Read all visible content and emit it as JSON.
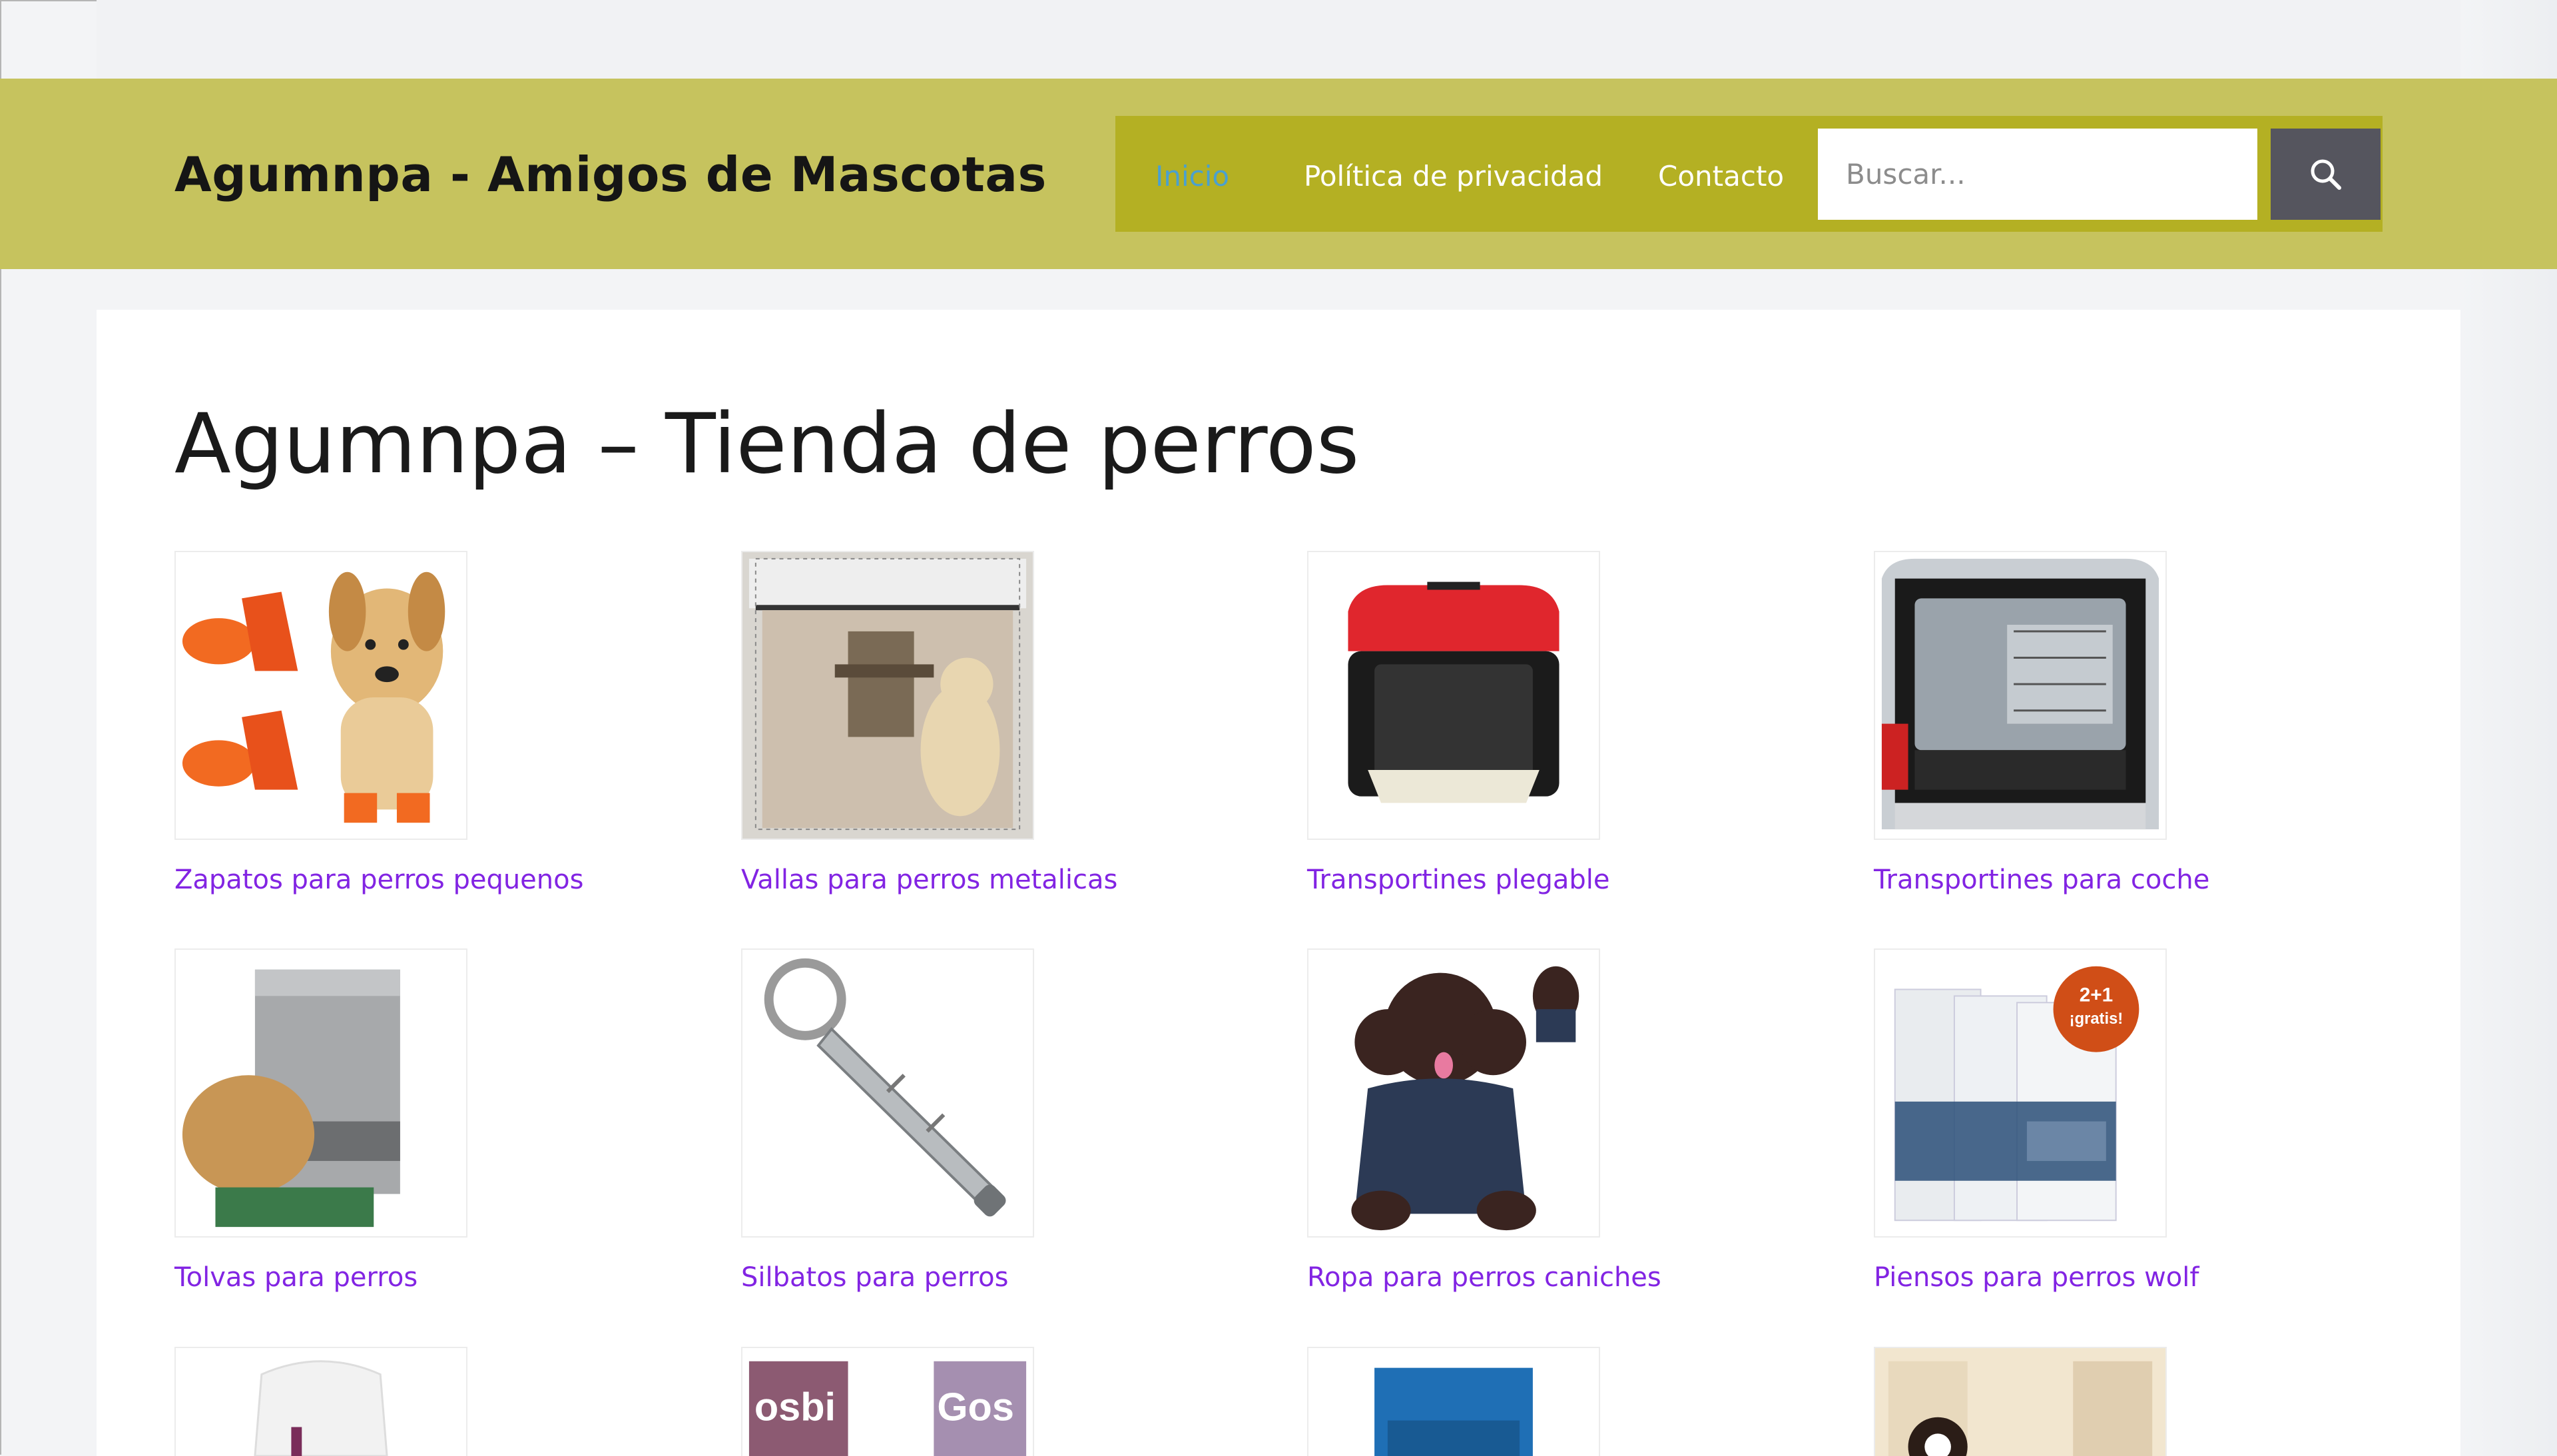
{
  "site": {
    "title": "Agumnpa - Amigos de Mascotas"
  },
  "nav": {
    "items": [
      {
        "label": "Inicio",
        "active": true
      },
      {
        "label": "Política de privacidad",
        "active": false
      },
      {
        "label": "Contacto",
        "active": false
      }
    ]
  },
  "search": {
    "placeholder": "Buscar...",
    "value": "",
    "icon": "search-icon"
  },
  "main": {
    "title": "Agumnpa – Tienda de perros",
    "products": [
      {
        "label": "Zapatos para perros pequenos",
        "image": "puppy-with-orange-shoes"
      },
      {
        "label": "Vallas para perros metalicas",
        "image": "dog-behind-mesh-fence"
      },
      {
        "label": "Transportines plegable",
        "image": "red-black-soft-crate"
      },
      {
        "label": "Transportines para coche",
        "image": "crate-in-car-trunk"
      },
      {
        "label": "Tolvas para perros",
        "image": "dog-eating-from-metal-feeder"
      },
      {
        "label": "Silbatos para perros",
        "image": "silver-dog-whistle"
      },
      {
        "label": "Ropa para perros caniches",
        "image": "poodle-in-jacket"
      },
      {
        "label": "Piensos para perros wolf",
        "image": "wolf-dog-food-bags"
      },
      {
        "label": "",
        "image": "food-bag-white"
      },
      {
        "label": "",
        "image": "gosbi-food-bags"
      },
      {
        "label": "",
        "image": "blue-food-bag"
      },
      {
        "label": "",
        "image": "dog-in-room"
      }
    ],
    "badge_text": "2+1 ¡gratis!",
    "bag_text_1": "osbi",
    "bag_text_2": "Gos"
  },
  "colors": {
    "header": "#c6c35e",
    "nav": "#b4b023",
    "link": "#8224e3",
    "active": "#4aa0cf",
    "search_button": "#55555e"
  }
}
